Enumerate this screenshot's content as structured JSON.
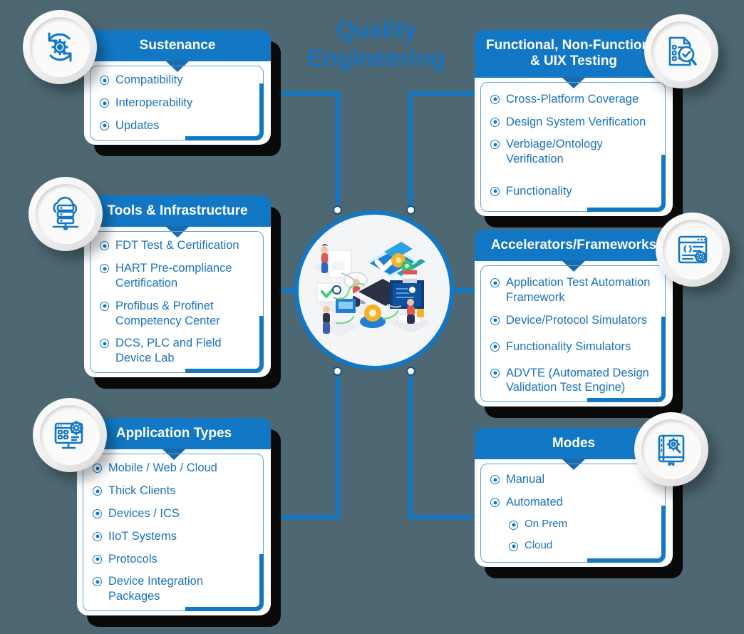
{
  "diagram": {
    "title": "Quality Engineering",
    "center_icon": "quality-engineering-isometric-illustration",
    "accent_color": "#1277c4",
    "background_color": "#4d6873",
    "text_color": "#1a72bc"
  },
  "cards": [
    {
      "id": "sustenance",
      "title": "Sustenance",
      "icon": "refresh-gear-icon",
      "items": [
        {
          "label": "Compatibility",
          "level": 0
        },
        {
          "label": "Interoperability",
          "level": 0
        },
        {
          "label": "Updates",
          "level": 0
        }
      ]
    },
    {
      "id": "tools",
      "title": "Tools & Infrastructure",
      "icon": "cloud-server-icon",
      "items": [
        {
          "label": "FDT Test & Certification",
          "level": 0
        },
        {
          "label": "HART Pre-compliance Certification",
          "level": 0
        },
        {
          "label": "Profibus & Profinet Competency Center",
          "level": 0
        },
        {
          "label": "DCS, PLC and Field Device Lab",
          "level": 0
        }
      ]
    },
    {
      "id": "apptypes",
      "title": "Application Types",
      "icon": "monitor-gear-icon",
      "items": [
        {
          "label": "Mobile / Web / Cloud",
          "level": 0
        },
        {
          "label": "Thick Clients",
          "level": 0
        },
        {
          "label": "Devices / ICS",
          "level": 0
        },
        {
          "label": "IIoT Systems",
          "level": 0
        },
        {
          "label": "Protocols",
          "level": 0
        },
        {
          "label": "Device Integration Packages",
          "level": 0
        }
      ]
    },
    {
      "id": "functional",
      "title": "Functional, Non-Functional & UIX Testing",
      "icon": "document-search-check-icon",
      "items": [
        {
          "label": "Cross-Platform Coverage",
          "level": 0
        },
        {
          "label": "Design System Verification",
          "level": 0
        },
        {
          "label": "Verbiage/Ontology Verification",
          "level": 0
        },
        {
          "label": "Functionality",
          "level": 0
        }
      ]
    },
    {
      "id": "accelerators",
      "title": "Accelerators/Frameworks",
      "icon": "code-window-gear-icon",
      "items": [
        {
          "label": "Application Test Automation Framework",
          "level": 0
        },
        {
          "label": "Device/Protocol Simulators",
          "level": 0
        },
        {
          "label": "Functionality Simulators",
          "level": 0
        },
        {
          "label": "ADVTE (Automated Design Validation Test Engine)",
          "level": 0
        }
      ]
    },
    {
      "id": "modes",
      "title": "Modes",
      "icon": "book-gear-icon",
      "items": [
        {
          "label": "Manual",
          "level": 0
        },
        {
          "label": "Automated",
          "level": 0
        },
        {
          "label": "On Prem",
          "level": 1
        },
        {
          "label": "Cloud",
          "level": 1
        }
      ]
    }
  ]
}
